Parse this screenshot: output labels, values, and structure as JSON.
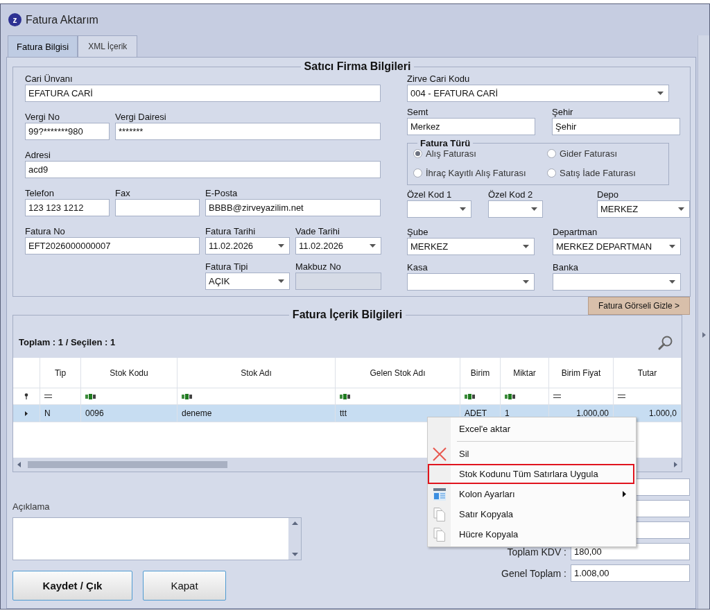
{
  "window": {
    "title": "Fatura Aktarım",
    "icon_letter": "z"
  },
  "tabs": [
    {
      "label": "Fatura Bilgisi",
      "selected": true
    },
    {
      "label": "XML İçerik",
      "selected": false
    }
  ],
  "seller": {
    "title": "Satıcı Firma Bilgileri",
    "left_rows": [
      [
        {
          "label": "Cari Ünvanı",
          "value": "EFATURA CARİ",
          "kind": "text",
          "disabled": false
        }
      ],
      [
        {
          "label": "Vergi No",
          "value": "99?*******980",
          "kind": "text",
          "disabled": false
        },
        {
          "label": "Vergi Dairesi",
          "value": "*******",
          "kind": "text",
          "disabled": false
        }
      ],
      [
        {
          "label": "Adresi",
          "value": "acd9",
          "kind": "text",
          "disabled": false
        }
      ],
      [
        {
          "label": "Telefon",
          "value": "123 123 1212",
          "kind": "text",
          "disabled": false
        },
        {
          "label": "Fax",
          "kind": "text",
          "disabled": false
        },
        {
          "label": "E-Posta",
          "value": "BBBB@zirveyazilim.net",
          "kind": "text",
          "disabled": false
        }
      ],
      [
        {
          "label": "Fatura No",
          "value": "EFT2026000000007",
          "kind": "text",
          "disabled": false
        },
        {
          "label": "Fatura Tarihi",
          "value": "11.02.2026",
          "kind": "combo",
          "disabled": false
        },
        {
          "label": "Vade Tarihi",
          "value": "11.02.2026",
          "kind": "combo",
          "disabled": false
        }
      ],
      [
        {
          "label": "Fatura Tipi",
          "value": "AÇIK",
          "kind": "combo",
          "disabled": false
        },
        {
          "label": "Makbuz No",
          "kind": "text",
          "disabled": true
        }
      ]
    ],
    "right_rows": [
      [
        {
          "label": "Zirve Cari Kodu",
          "value": "004 - EFATURA CARİ",
          "kind": "combo",
          "disabled": false
        }
      ],
      [
        {
          "label": "Semt",
          "value": "Merkez",
          "kind": "text",
          "disabled": false
        },
        {
          "label": "Şehir",
          "value": "Şehir",
          "kind": "text",
          "disabled": false
        }
      ],
      [
        {
          "label": "Özel Kod 1",
          "kind": "combo",
          "disabled": false
        },
        {
          "label": "Özel Kod 2",
          "kind": "combo",
          "disabled": false
        },
        {
          "label": "Depo",
          "value": "MERKEZ",
          "kind": "combo",
          "disabled": false
        }
      ],
      [
        {
          "label": "Şube",
          "value": "MERKEZ",
          "kind": "combo",
          "disabled": false
        },
        {
          "label": "Departman",
          "value": "MERKEZ DEPARTMAN",
          "kind": "combo",
          "disabled": false
        }
      ],
      [
        {
          "label": "Kasa",
          "kind": "combo",
          "disabled": false
        },
        {
          "label": "Banka",
          "kind": "combo",
          "disabled": false
        }
      ]
    ],
    "invoice_type": {
      "title": "Fatura Türü",
      "options": [
        {
          "label": "Alış Faturası",
          "selected": true
        },
        {
          "label": "Gider Faturası",
          "selected": false
        },
        {
          "label": "İhraç Kayıtlı Alış Faturası",
          "selected": false
        },
        {
          "label": "Satış İade Faturası",
          "selected": false
        }
      ]
    }
  },
  "toggle_button": "Fatura Görseli Gizle >",
  "content": {
    "title": "Fatura İçerik Bilgileri",
    "summary": "Toplam : 1 / Seçilen : 1",
    "columns": [
      "Tip",
      "Stok Kodu",
      "Stok Adı",
      "Gelen Stok Adı",
      "Birim",
      "Miktar",
      "Birim Fiyat",
      "Tutar"
    ],
    "rows": [
      {
        "selected": true,
        "cells": [
          "N",
          "0096",
          "deneme",
          "ttt",
          "ADET",
          "1",
          "1.000,00",
          "1.000,0"
        ]
      }
    ]
  },
  "description": {
    "label": "Açıklama"
  },
  "totals": [
    {
      "label": "Toplam KDV :",
      "value": "180,00"
    },
    {
      "label": "Genel Toplam :",
      "value": "1.008,00"
    }
  ],
  "buttons": [
    {
      "label": "Kaydet / Çık",
      "kind": "primary"
    },
    {
      "label": "Kapat",
      "kind": "normal"
    }
  ],
  "context_menu": [
    {
      "kind": "plain",
      "label": "Excel'e aktar",
      "submenu": false,
      "highlighted": false
    },
    {
      "kind": "separator"
    },
    {
      "kind": "delete",
      "label": "Sil",
      "submenu": false,
      "highlighted": false
    },
    {
      "kind": "plain",
      "label": "Stok Kodunu Tüm Satırlara Uygula",
      "submenu": false,
      "highlighted": true
    },
    {
      "kind": "columns",
      "label": "Kolon Ayarları",
      "submenu": true,
      "highlighted": false
    },
    {
      "kind": "copy",
      "label": "Satır Kopyala",
      "submenu": false,
      "highlighted": false
    },
    {
      "kind": "copy",
      "label": "Hücre Kopyala",
      "submenu": false,
      "highlighted": false
    }
  ]
}
